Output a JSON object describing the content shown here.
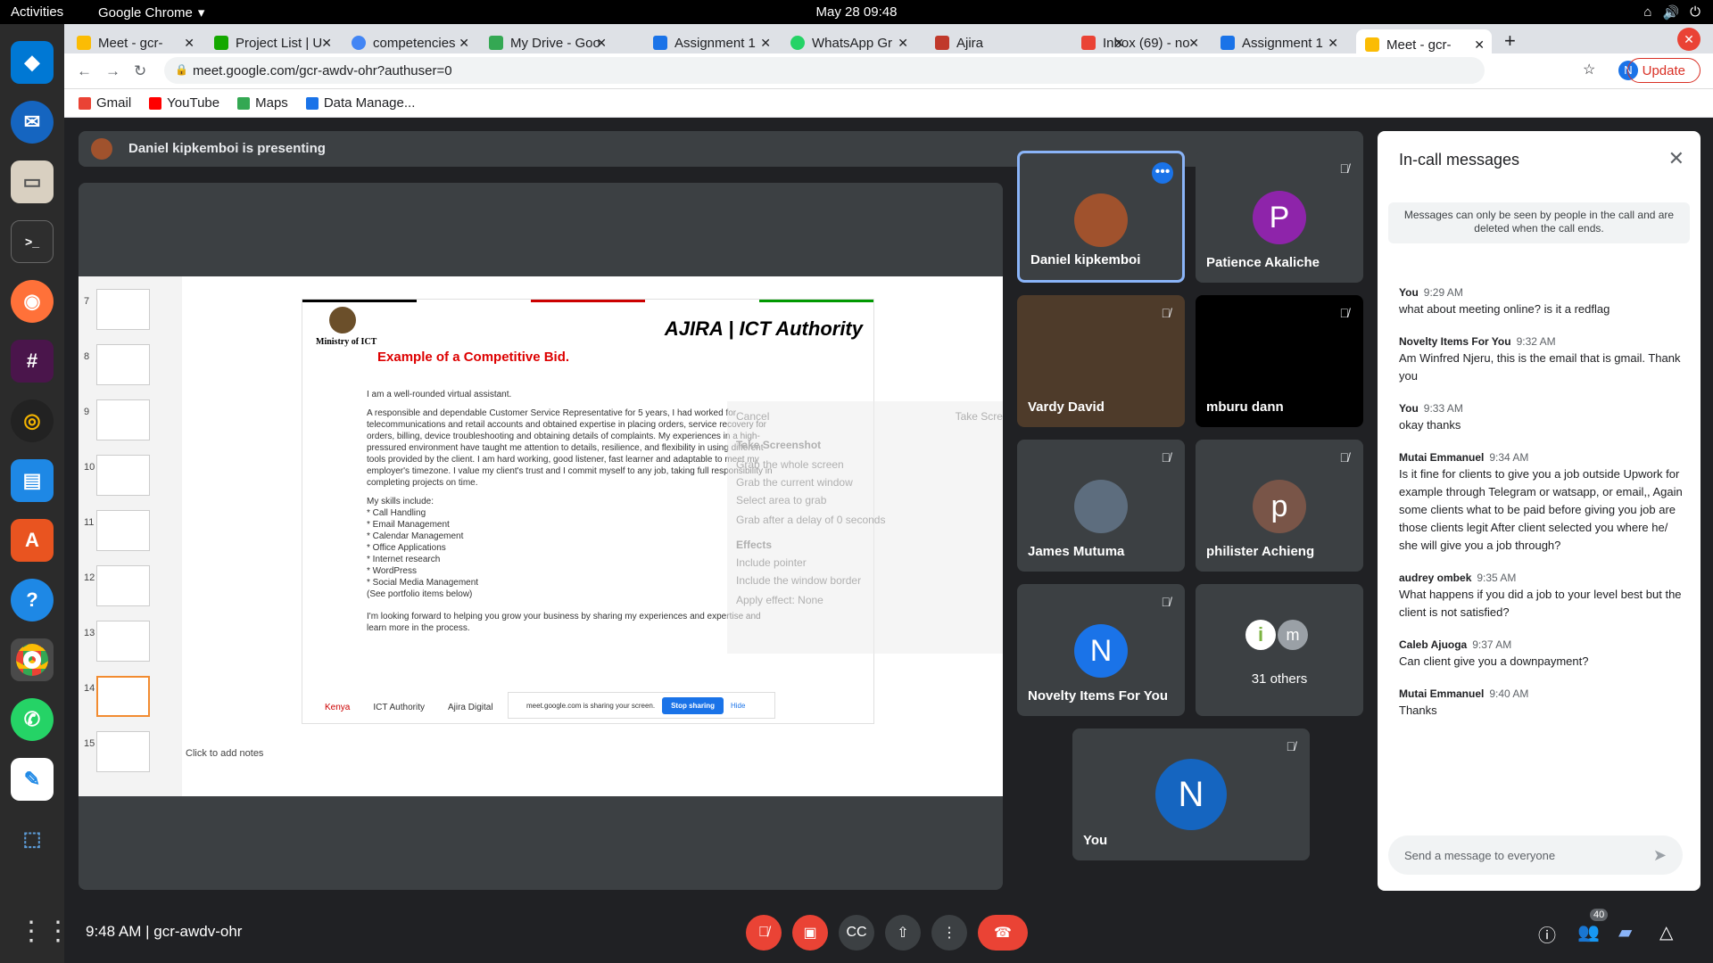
{
  "system": {
    "activities": "Activities",
    "app": "Google Chrome",
    "clock": "May 28  09:48"
  },
  "tabs": [
    {
      "label": "Meet - gcr-",
      "color": "#fbbc04"
    },
    {
      "label": "Project List | U",
      "color": "#14a800"
    },
    {
      "label": "competencies",
      "color": "#4285f4"
    },
    {
      "label": "My Drive - Goo",
      "color": "#34a853"
    },
    {
      "label": "Assignment 1",
      "color": "#1a73e8"
    },
    {
      "label": "WhatsApp Gr",
      "color": "#25d366"
    },
    {
      "label": "Ajira",
      "color": "#c0392b"
    },
    {
      "label": "Inbox (69) - no",
      "color": "#ea4335"
    },
    {
      "label": "Assignment 1",
      "color": "#1a73e8"
    },
    {
      "label": "Meet - gcr-",
      "color": "#fbbc04"
    }
  ],
  "url": "meet.google.com/gcr-awdv-ohr?authuser=0",
  "update_label": "Update",
  "bookmarks": [
    {
      "label": "Gmail",
      "color": "#ea4335"
    },
    {
      "label": "YouTube",
      "color": "#ff0000"
    },
    {
      "label": "Maps",
      "color": "#34a853"
    },
    {
      "label": "Data Manage...",
      "color": "#1a73e8"
    }
  ],
  "banner": "Daniel kipkemboi is presenting",
  "slides": {
    "thumb_numbers": [
      "7",
      "8",
      "9",
      "10",
      "11",
      "12",
      "13",
      "14",
      "15"
    ],
    "ministry": "Ministry of ICT",
    "logos": "AJIRA | ICT Authority",
    "title": "Example of a Competitive Bid.",
    "p1": "I am a well-rounded virtual assistant.",
    "p2": "A responsible and dependable Customer Service Representative for 5 years, I had worked for telecommunications and retail accounts and obtained expertise in placing orders, service recovery for orders, billing, device troubleshooting and obtaining details of complaints. My experiences in a high-pressured environment have taught me attention to details, resilience, and flexibility in using different tools provided by the client. I am hard working, good listener, fast learner and adaptable to meet my employer's timezone. I value my client's trust and I commit myself to any job, taking full responsibility in completing projects on time.",
    "skills_title": "My skills include:",
    "skills": [
      "* Call Handling",
      "* Email Management",
      "* Calendar Management",
      "* Office Applications",
      "* Internet research",
      "* WordPress",
      "* Social Media Management",
      "(See portfolio items below)"
    ],
    "closing": "I'm looking forward to helping you grow your business by sharing my experiences and expertise and learn more in the process.",
    "footer": [
      "Kenya",
      "ICT Authority",
      "Ajira Digital"
    ],
    "share_text": "meet.google.com is sharing your screen.",
    "stop_label": "Stop sharing",
    "hide_label": "Hide",
    "notes": "Click to add notes"
  },
  "screenshot_dialog": {
    "cancel": "Cancel",
    "take": "Take Screenshot",
    "heading": "Take Screenshot",
    "opt1": "Grab the whole screen",
    "opt2": "Grab the current window",
    "opt3": "Select area to grab",
    "delay": "Grab after a delay of",
    "delay_value": "0",
    "seconds": "seconds",
    "effects": "Effects",
    "pointer": "Include pointer",
    "border": "Include the window border",
    "apply": "Apply effect:",
    "none": "None"
  },
  "participants": [
    {
      "name": "Daniel kipkemboi",
      "initial": "",
      "color": "#a0522d"
    },
    {
      "name": "Patience Akaliche",
      "initial": "P",
      "color": "#8e24aa"
    },
    {
      "name": "Vardy David",
      "initial": "",
      "color": "#4e3b2a"
    },
    {
      "name": "mburu dann",
      "initial": "",
      "color": "#000000"
    },
    {
      "name": "James Mutuma",
      "initial": "",
      "color": "#5d6d7e"
    },
    {
      "name": "philister Achieng",
      "initial": "p",
      "color": "#795548"
    },
    {
      "name": "Novelty Items For You",
      "initial": "N",
      "color": "#1a73e8"
    },
    {
      "name": "31 others",
      "initial": "m",
      "color": "#9aa0a6"
    },
    {
      "name": "You",
      "initial": "N",
      "color": "#1565c0"
    }
  ],
  "panel": {
    "title": "In-call messages",
    "note": "Messages can only be seen by people in the call and are deleted when the call ends.",
    "messages": [
      {
        "from": "You",
        "time": "9:29 AM",
        "text": "what about meeting online? is it a redflag"
      },
      {
        "from": "Novelty Items For You",
        "time": "9:32 AM",
        "text": "Am Winfred Njeru, this is the email that is gmail. Thank you"
      },
      {
        "from": "You",
        "time": "9:33 AM",
        "text": "okay thanks"
      },
      {
        "from": "Mutai Emmanuel",
        "time": "9:34 AM",
        "text": "Is it fine for clients to give you a job outside Upwork for example through Telegram or watsapp, or email,, Again some clients what to be paid before giving you job are those clients legit After client selected you where he/ she will give you a job through?"
      },
      {
        "from": "audrey ombek",
        "time": "9:35 AM",
        "text": "What happens if you did a job to your level best but the client is not satisfied?"
      },
      {
        "from": "Caleb Ajuoga",
        "time": "9:37 AM",
        "text": "Can client give you a downpayment?"
      },
      {
        "from": "Mutai Emmanuel",
        "time": "9:40 AM",
        "text": "Thanks"
      }
    ],
    "placeholder": "Send a message to everyone"
  },
  "footer": {
    "time": "9:48 AM",
    "code": "gcr-awdv-ohr",
    "people_count": "40"
  }
}
